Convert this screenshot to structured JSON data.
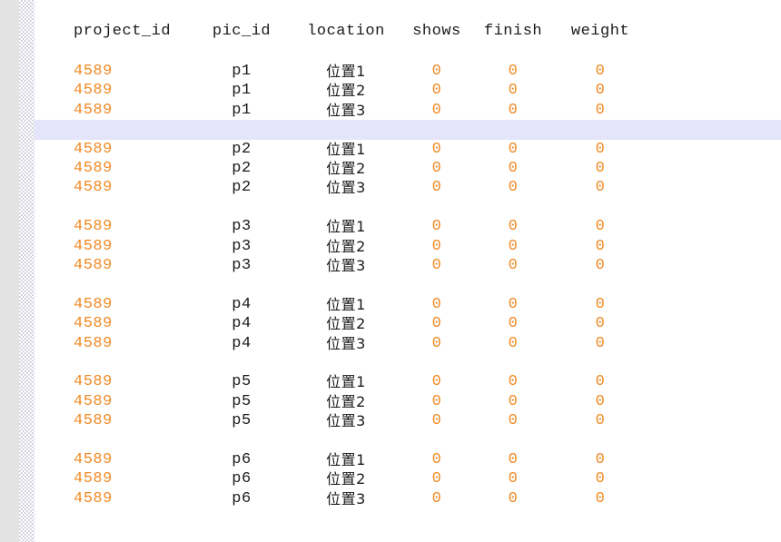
{
  "table": {
    "headers": [
      "project_id",
      "pic_id",
      "location",
      "shows",
      "finish",
      "weight"
    ],
    "colors": {
      "number": "#f08a24",
      "text": "#1a1a1a",
      "highlight": "#e4e4fa",
      "gutter": "#e3e3e3"
    },
    "groups": [
      {
        "pic_id": "p1",
        "rows": [
          {
            "project_id": "4589",
            "pic_id": "p1",
            "location": "位置1",
            "shows": "0",
            "finish": "0",
            "weight": "0"
          },
          {
            "project_id": "4589",
            "pic_id": "p1",
            "location": "位置2",
            "shows": "0",
            "finish": "0",
            "weight": "0"
          },
          {
            "project_id": "4589",
            "pic_id": "p1",
            "location": "位置3",
            "shows": "0",
            "finish": "0",
            "weight": "0"
          }
        ]
      },
      {
        "pic_id": "p2",
        "rows": [
          {
            "project_id": "4589",
            "pic_id": "p2",
            "location": "位置1",
            "shows": "0",
            "finish": "0",
            "weight": "0"
          },
          {
            "project_id": "4589",
            "pic_id": "p2",
            "location": "位置2",
            "shows": "0",
            "finish": "0",
            "weight": "0"
          },
          {
            "project_id": "4589",
            "pic_id": "p2",
            "location": "位置3",
            "shows": "0",
            "finish": "0",
            "weight": "0"
          }
        ]
      },
      {
        "pic_id": "p3",
        "rows": [
          {
            "project_id": "4589",
            "pic_id": "p3",
            "location": "位置1",
            "shows": "0",
            "finish": "0",
            "weight": "0"
          },
          {
            "project_id": "4589",
            "pic_id": "p3",
            "location": "位置2",
            "shows": "0",
            "finish": "0",
            "weight": "0"
          },
          {
            "project_id": "4589",
            "pic_id": "p3",
            "location": "位置3",
            "shows": "0",
            "finish": "0",
            "weight": "0"
          }
        ]
      },
      {
        "pic_id": "p4",
        "rows": [
          {
            "project_id": "4589",
            "pic_id": "p4",
            "location": "位置1",
            "shows": "0",
            "finish": "0",
            "weight": "0"
          },
          {
            "project_id": "4589",
            "pic_id": "p4",
            "location": "位置2",
            "shows": "0",
            "finish": "0",
            "weight": "0"
          },
          {
            "project_id": "4589",
            "pic_id": "p4",
            "location": "位置3",
            "shows": "0",
            "finish": "0",
            "weight": "0"
          }
        ]
      },
      {
        "pic_id": "p5",
        "rows": [
          {
            "project_id": "4589",
            "pic_id": "p5",
            "location": "位置1",
            "shows": "0",
            "finish": "0",
            "weight": "0"
          },
          {
            "project_id": "4589",
            "pic_id": "p5",
            "location": "位置2",
            "shows": "0",
            "finish": "0",
            "weight": "0"
          },
          {
            "project_id": "4589",
            "pic_id": "p5",
            "location": "位置3",
            "shows": "0",
            "finish": "0",
            "weight": "0"
          }
        ]
      },
      {
        "pic_id": "p6",
        "rows": [
          {
            "project_id": "4589",
            "pic_id": "p6",
            "location": "位置1",
            "shows": "0",
            "finish": "0",
            "weight": "0"
          },
          {
            "project_id": "4589",
            "pic_id": "p6",
            "location": "位置2",
            "shows": "0",
            "finish": "0",
            "weight": "0"
          },
          {
            "project_id": "4589",
            "pic_id": "p6",
            "location": "位置3",
            "shows": "0",
            "finish": "0",
            "weight": "0"
          }
        ]
      }
    ],
    "highlighted_gap_after_group": 0
  }
}
